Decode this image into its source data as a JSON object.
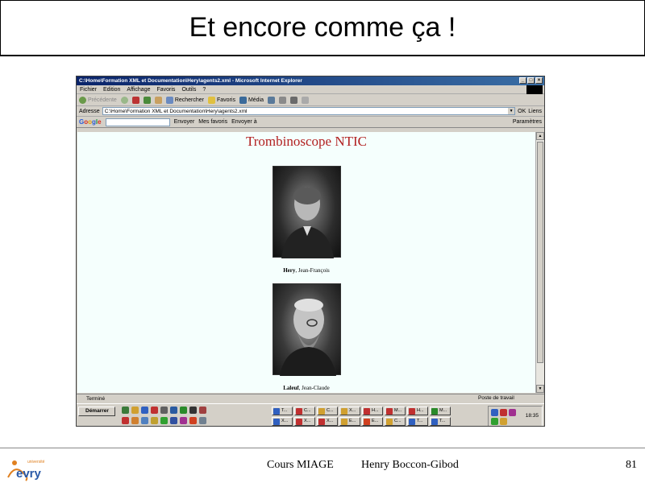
{
  "slide": {
    "title": "Et encore comme ça !",
    "footer": {
      "course": "Cours MIAGE",
      "author": "Henry Boccon-Gibod",
      "page": "81"
    },
    "logo_text": "université evry"
  },
  "browser": {
    "window_title": "C:\\Home\\Formation XML et Documentation\\Hery\\agents2.xml - Microsoft Internet Explorer",
    "menu": [
      "Fichier",
      "Edition",
      "Affichage",
      "Favoris",
      "Outils",
      "?"
    ],
    "toolbar": {
      "back": "Précédente",
      "search": "Rechercher",
      "favorites": "Favoris",
      "media": "Média"
    },
    "address": {
      "label": "Adresse",
      "value": "C:\\Home\\Formation XML et Documentation\\Hery\\agents2.xml",
      "go": "OK",
      "links": "Liens"
    },
    "google_bar": {
      "search_button": "Envoyer",
      "news": "Mes favoris",
      "send": "Envoyer à",
      "options": "Paramètres"
    },
    "status": {
      "left": "Terminé",
      "right": "Poste de travail"
    }
  },
  "page": {
    "heading": "Trombinoscope NTIC",
    "people": [
      {
        "last": "Hery",
        "first": "Jean-François"
      },
      {
        "last": "Laleuf",
        "first": "Jean-Claude"
      }
    ]
  },
  "taskbar": {
    "start": "Démarrer",
    "clock": "18:35",
    "tasks_row1": [
      "T...",
      "C...",
      "C...",
      "X...",
      "H...",
      "M...",
      "H...",
      "M..."
    ],
    "tasks_row2": [
      "X...",
      "X...",
      "X...",
      "E...",
      "E...",
      "C...",
      "T...",
      "T..."
    ]
  },
  "colors": {
    "heading": "#b22020",
    "titlebar": "#0a246a",
    "content_bg": "#f5fffd"
  }
}
